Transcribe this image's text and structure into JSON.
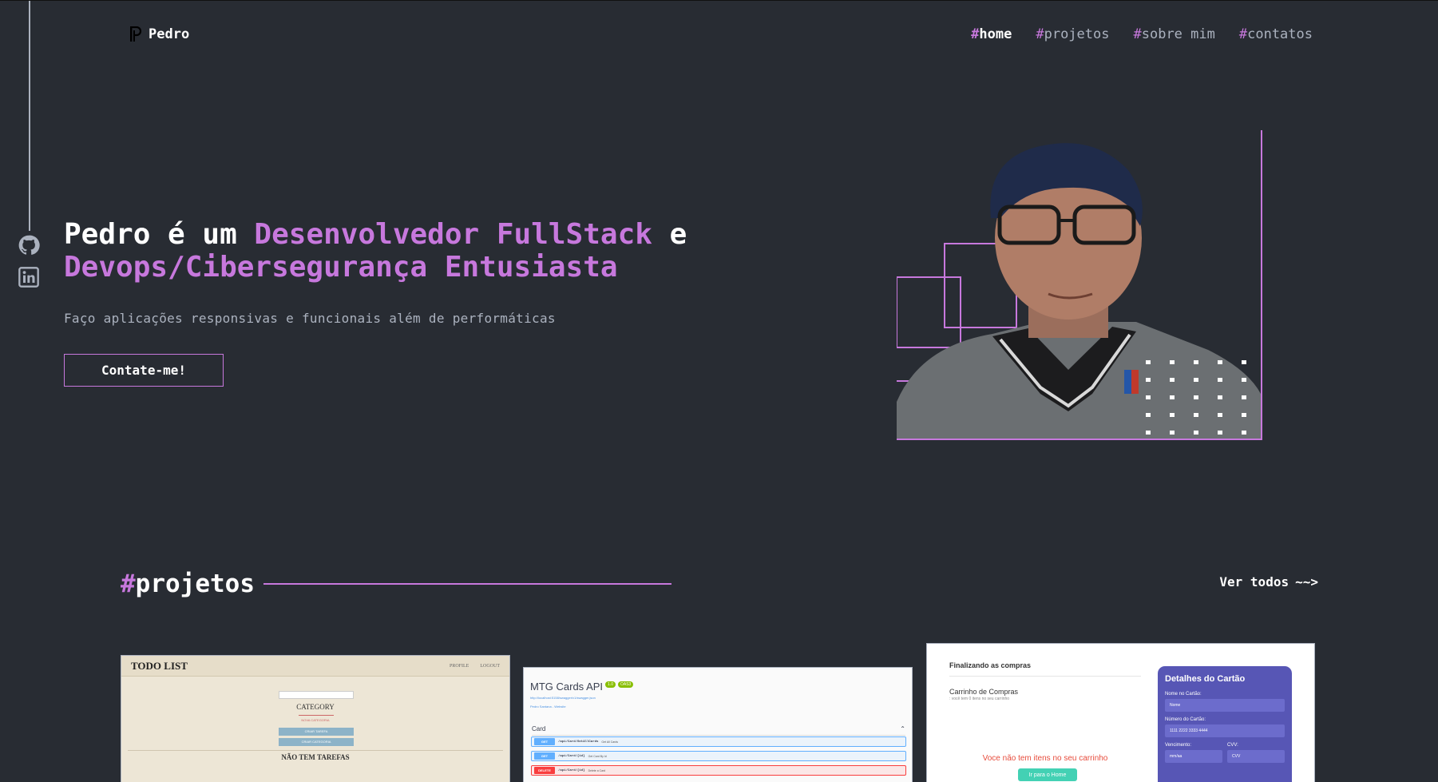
{
  "brand": {
    "name": "Pedro"
  },
  "nav": [
    {
      "hash": "#",
      "label": "home",
      "active": true
    },
    {
      "hash": "#",
      "label": "projetos",
      "active": false
    },
    {
      "hash": "#",
      "label": "sobre mim",
      "active": false
    },
    {
      "hash": "#",
      "label": "contatos",
      "active": false
    }
  ],
  "social": [
    "github-icon",
    "linkedin-icon"
  ],
  "hero": {
    "title_part1": "Pedro é um ",
    "title_accent1": "Desenvolvedor FullStack",
    "title_part2": " e ",
    "title_accent2": "Devops/Cibersegurança Entusiasta",
    "subtitle": "Faço aplicações responsivas e funcionais além de performáticas",
    "cta": "Contate-me!"
  },
  "projects": {
    "hash": "#",
    "title": "projetos",
    "see_all": "Ver todos",
    "see_all_arrow": "~~>",
    "todo": {
      "title": "TODO LIST",
      "links": [
        "PROFILE",
        "LOGOUT"
      ],
      "category": "CATEGORY",
      "small": "NOVA CATEGORIA",
      "buttons": [
        "CRIAR TAREFA",
        "CRIAR CATEGORIA"
      ],
      "empty": "NÃO TEM TAREFAS"
    },
    "api": {
      "title": "MTG Cards API",
      "badge1": "1.0",
      "badge2": "OAS3",
      "url": "http://localhost:5158/swagger/v1/swagger.json",
      "link": "Pedro Santana - Website",
      "section": "Card",
      "ops": [
        {
          "method": "GET",
          "path": "/api/Card/GetAllCards",
          "desc": "Get All Cards",
          "color": "#61affe",
          "bg": "#ebf3fb"
        },
        {
          "method": "GET",
          "path": "/api/Card/{id}",
          "desc": "Get Card By Id",
          "color": "#61affe",
          "bg": "#ebf3fb"
        },
        {
          "method": "DELETE",
          "path": "/api/Card/{id}",
          "desc": "Delete a Card",
          "color": "#f93e3e",
          "bg": "#fbe7e7"
        }
      ]
    },
    "checkout": {
      "heading": "Finalizando as compras",
      "cart": "Carrinho de Compras",
      "cart_sub": ": você tem 0 itens no seu carrinho",
      "empty": "Voce não tem itens no seu carrinho",
      "home_btn": "Ir para o Home",
      "panel_title": "Detalhes do Cartão",
      "name_label": "Nome no Cartão:",
      "name_value": "Nome",
      "number_label": "Número do Cartão:",
      "number_value": "1111 2222 3333 4444",
      "exp_label": "Vencimento:",
      "exp_value": "mm/aa",
      "cvv_label": "CVV:",
      "cvv_value": "CVV"
    }
  },
  "colors": {
    "background": "#282c33",
    "accent": "#c778dd",
    "gray": "#abb2bf",
    "white": "#ffffff"
  }
}
